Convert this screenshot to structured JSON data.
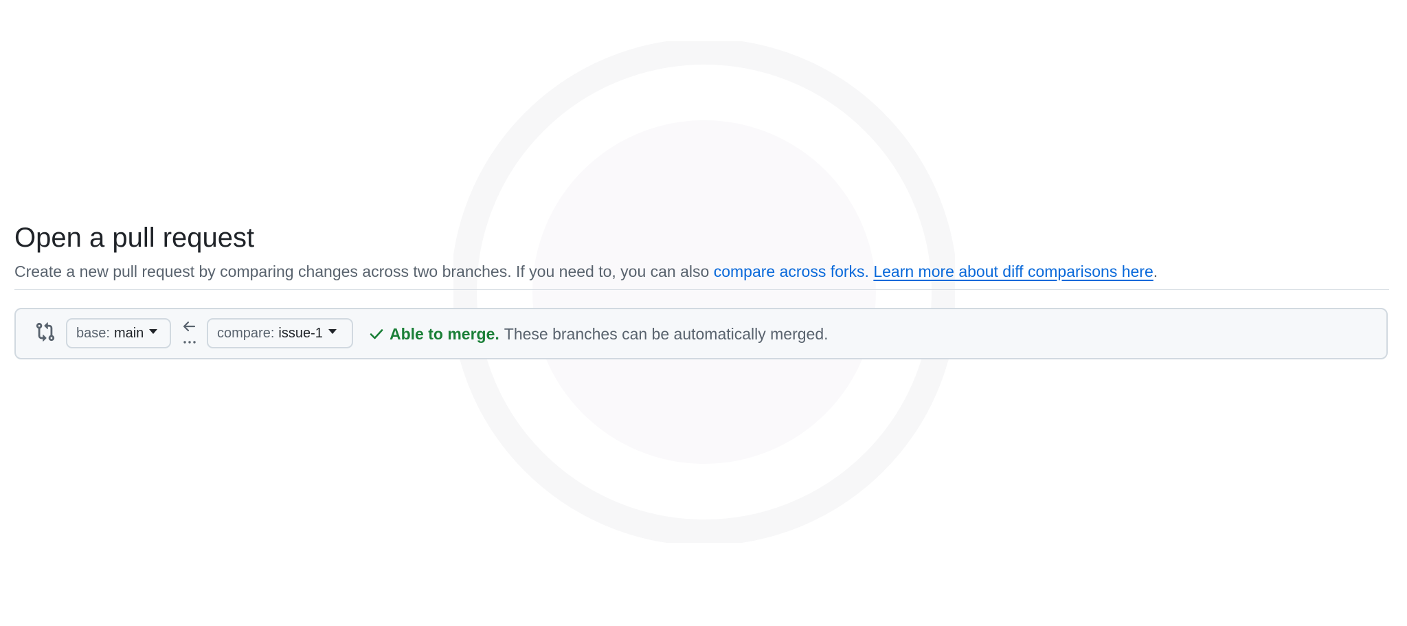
{
  "page": {
    "title": "Open a pull request",
    "description_text": "Create a new pull request by comparing changes across two branches. If you need to, you can also ",
    "compare_forks_link": "compare across forks.",
    "learn_more_link": "Learn more about diff comparisons here",
    "trailing_period": "."
  },
  "range": {
    "base_prefix": "base:",
    "base_branch": "main",
    "compare_prefix": "compare:",
    "compare_branch": "issue-1",
    "merge_status": "Able to merge.",
    "merge_detail": "These branches can be automatically merged."
  },
  "icons": {
    "compare": "git-compare-icon",
    "direction": "arrow-left-icon",
    "more": "ellipsis-icon",
    "status": "check-icon"
  },
  "colors": {
    "link": "#0969da",
    "success": "#1a7f37",
    "muted_text": "#59636e",
    "box_background": "#f6f8fa",
    "border": "#d1d9e0"
  }
}
